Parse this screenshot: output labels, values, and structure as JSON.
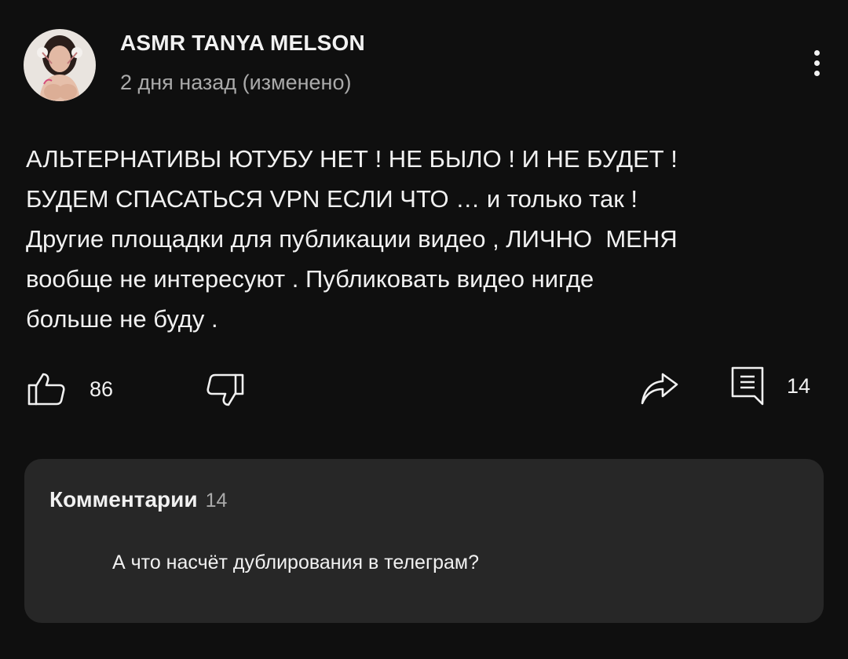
{
  "post": {
    "author": "ASMR TANYA MELSON",
    "timestamp": "2 дня назад (изменено)",
    "text_lines": [
      "АЛЬТЕРНАТИВЫ ЮТУБУ НЕТ ! НЕ БЫЛО ! И НЕ БУДЕТ !",
      "БУДЕМ СПАСАТЬСЯ VPN ЕСЛИ ЧТО … и только так !",
      "Другие площадки для публикации видео , ЛИЧНО  МЕНЯ",
      "вообще не интересуют . Публиковать видео нигде",
      "больше не буду ."
    ]
  },
  "actions": {
    "like_count": "86",
    "comment_count": "14"
  },
  "icons": {
    "like": "thumbs-up-icon",
    "dislike": "thumbs-down-icon",
    "share": "share-icon",
    "comment": "comment-icon",
    "menu": "more-vert-icon"
  },
  "comments_panel": {
    "title": "Комментарии",
    "count": "14",
    "preview": "А что насчёт дублирования в телеграм?"
  },
  "colors": {
    "background": "#0f0f0f",
    "card": "#272727",
    "text": "#f1f1f1",
    "secondary_text": "#aaaaaa"
  }
}
